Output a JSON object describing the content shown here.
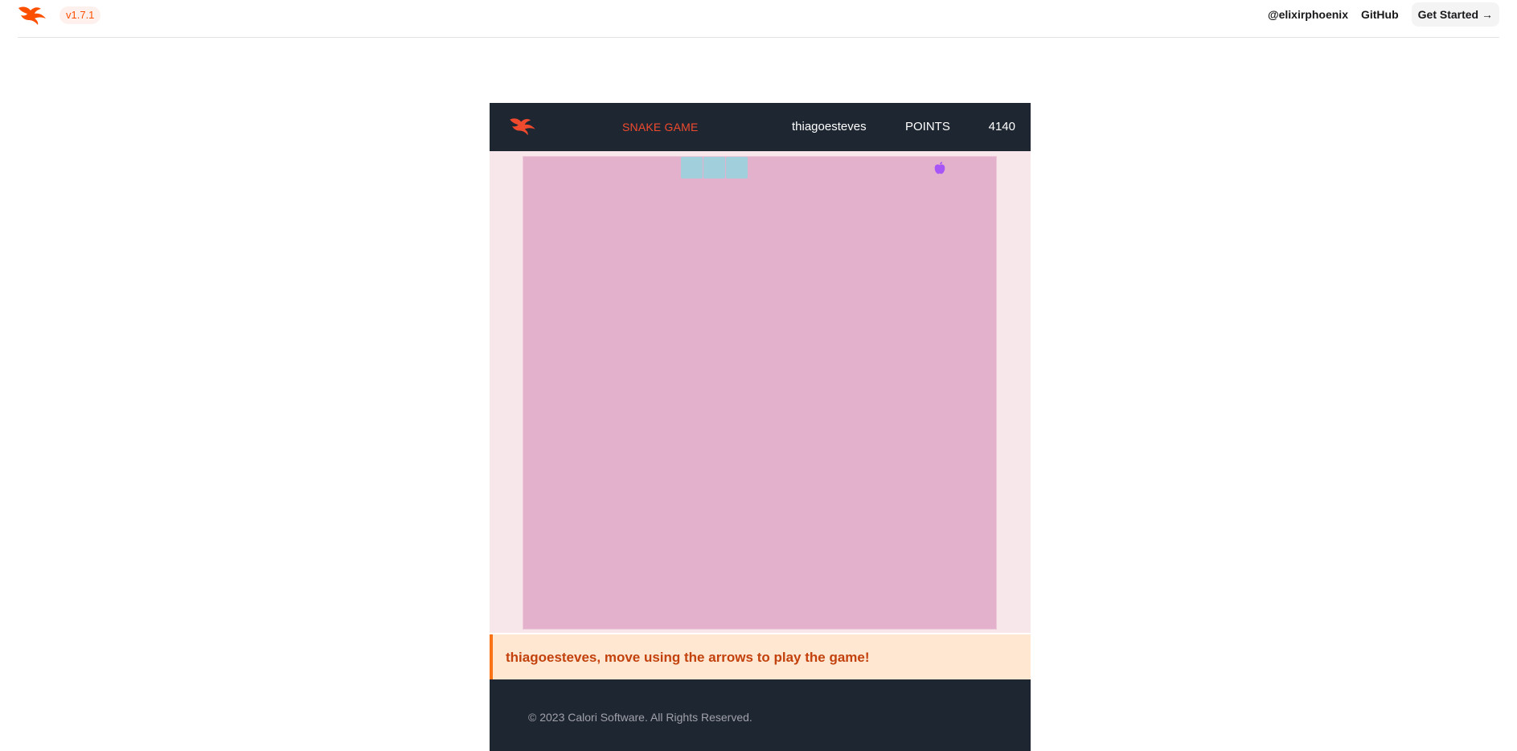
{
  "header": {
    "version": "v1.7.1",
    "links": [
      "@elixirphoenix",
      "GitHub"
    ],
    "cta": "Get Started →"
  },
  "game": {
    "title": "SNAKE GAME",
    "username": "thiagoesteves",
    "points_label": "POINTS",
    "points": "4140",
    "grid": {
      "cols": 21,
      "rows": 21
    },
    "snake": [
      [
        7,
        0
      ],
      [
        8,
        0
      ],
      [
        9,
        0
      ]
    ],
    "apple": [
      18,
      0
    ],
    "message": "thiagoesteves, move using the arrows to play the game!",
    "footer": "© 2023 Calori Software. All Rights Reserved."
  },
  "colors": {
    "accent": "#fd4f00",
    "game_bar": "#1e2631",
    "board": "#e3b1cc",
    "snake": "#a2cfdc",
    "apple": "#a855f7",
    "message_bg": "#ffe7d2",
    "message_text": "#c2410c"
  },
  "icons": [
    "phoenix-logo-icon",
    "apple-icon"
  ]
}
